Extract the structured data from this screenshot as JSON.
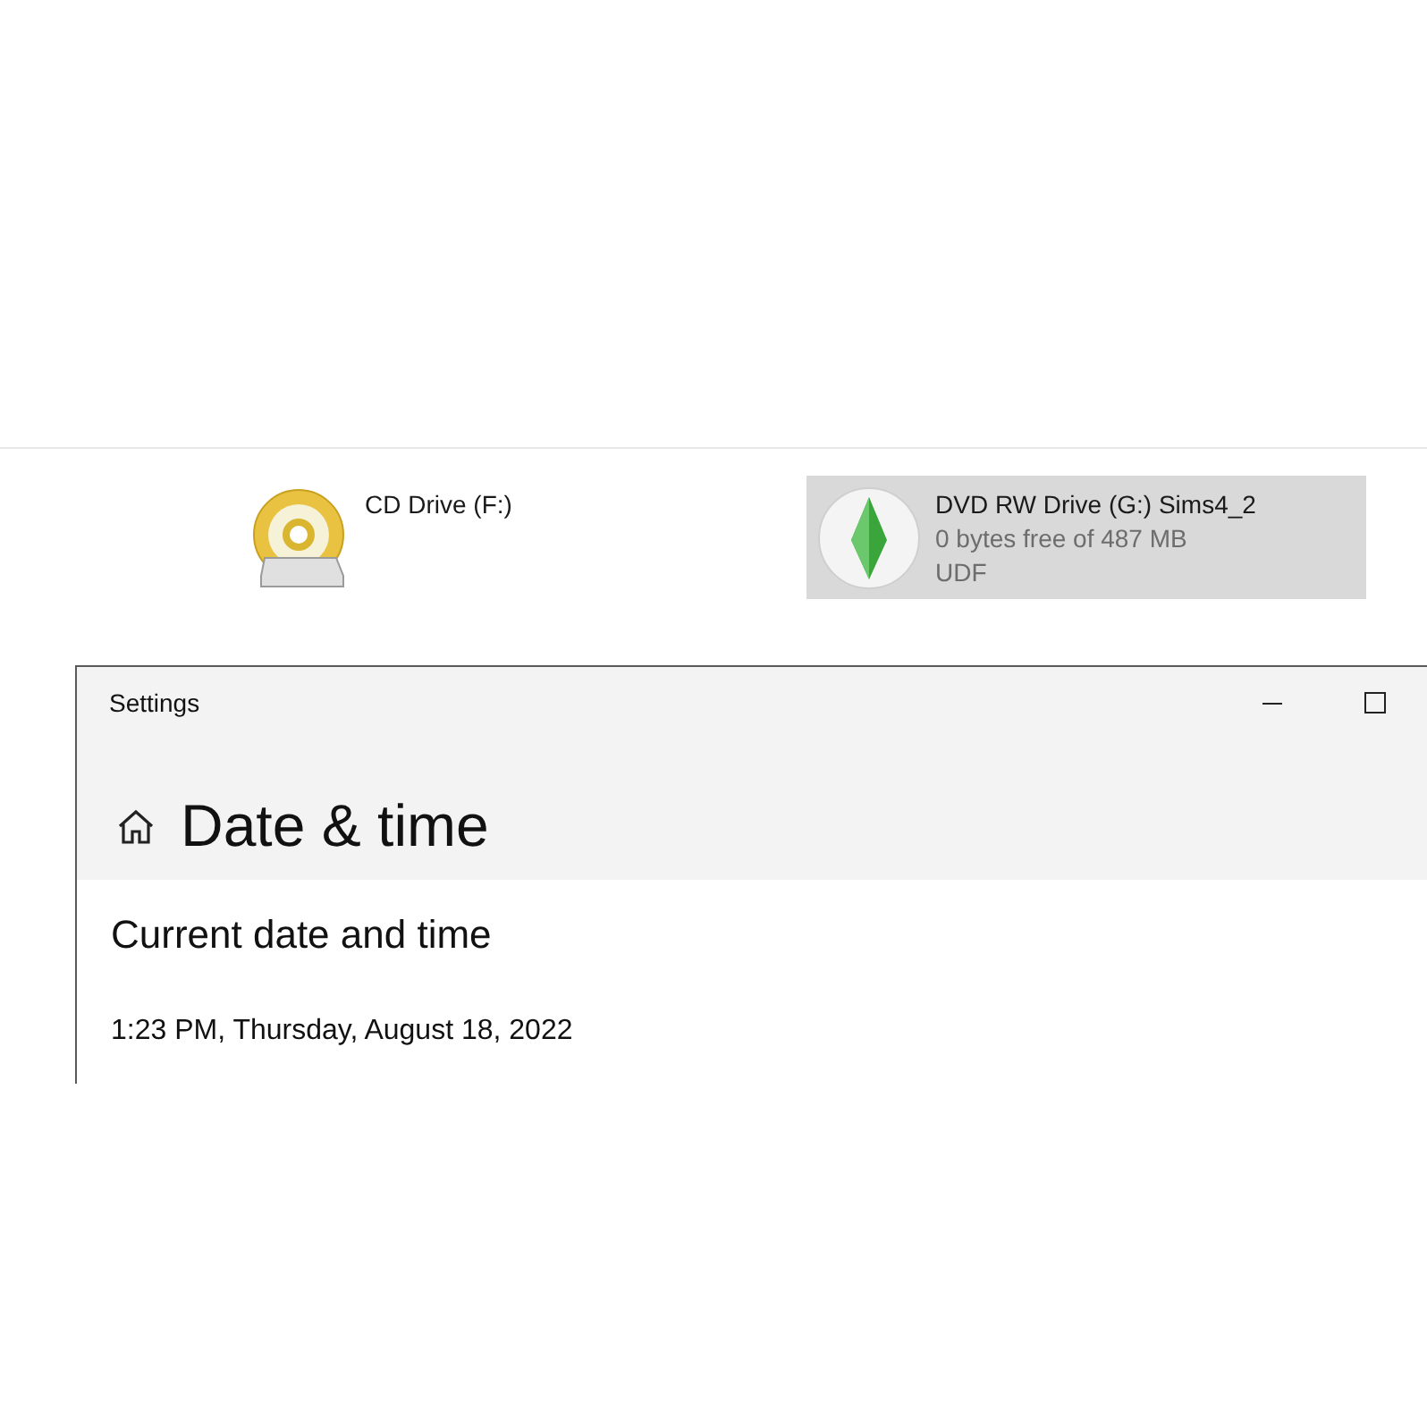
{
  "drives": [
    {
      "kind": "cd",
      "name": "CD Drive (F:)",
      "selected": false
    },
    {
      "kind": "dvd",
      "name": "DVD RW Drive (G:) Sims4_2",
      "details": [
        "0 bytes free of 487 MB",
        "UDF"
      ],
      "selected": true
    }
  ],
  "settings_window": {
    "title": "Settings",
    "page_title": "Date & time",
    "section_title": "Current date and time",
    "current_datetime": "1:23 PM, Thursday, August 18, 2022"
  }
}
